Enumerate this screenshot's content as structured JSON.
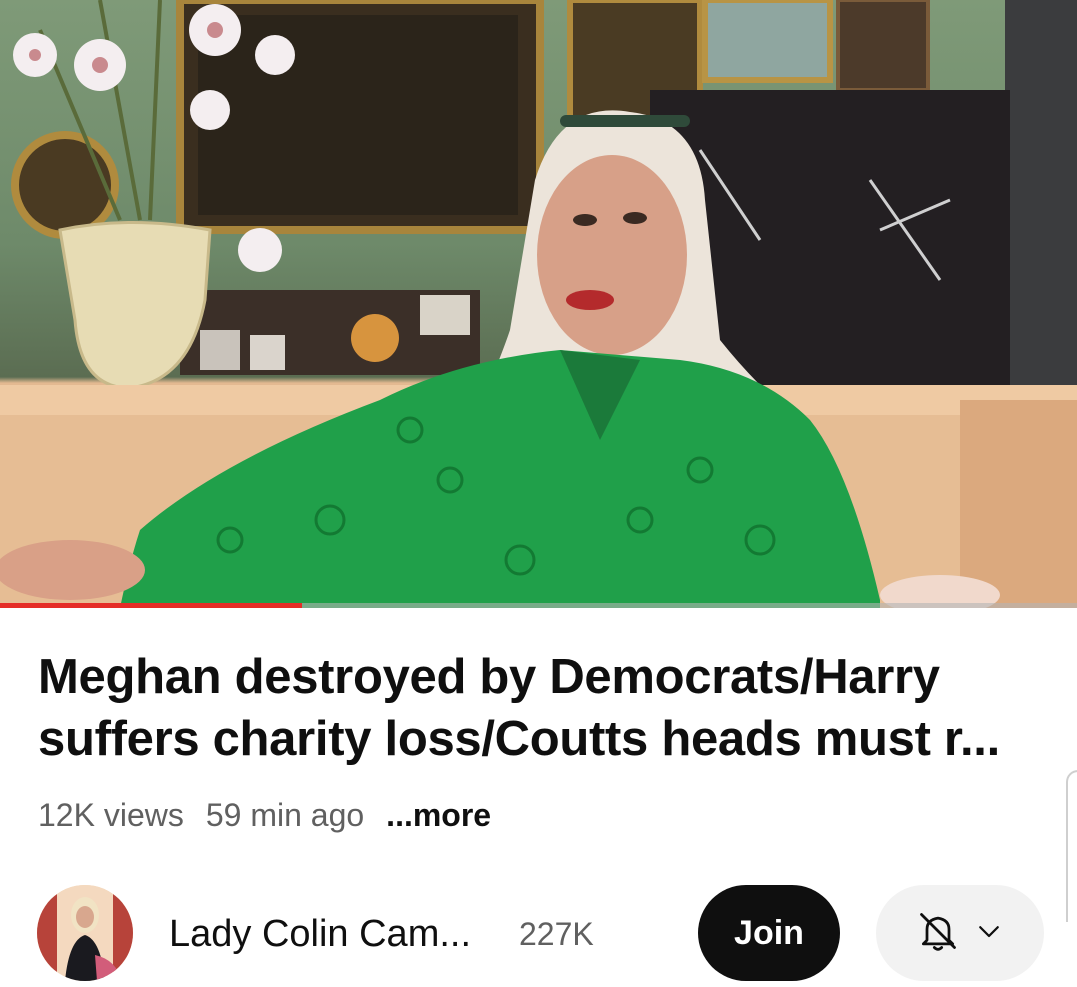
{
  "video": {
    "progress": 0.28,
    "progress_color": "#e52d27"
  },
  "title_lines": [
    "Meghan destroyed by Democrats/Harry",
    "suffers charity loss/Coutts heads must r..."
  ],
  "meta": {
    "views": "12K views",
    "age": "59 min ago",
    "more": "...more"
  },
  "channel": {
    "name": "Lady Colin Cam...",
    "subscribers": "227K",
    "join_label": "Join"
  },
  "icons": {
    "notification": "bell-off-icon",
    "dropdown": "chevron-down-icon"
  }
}
